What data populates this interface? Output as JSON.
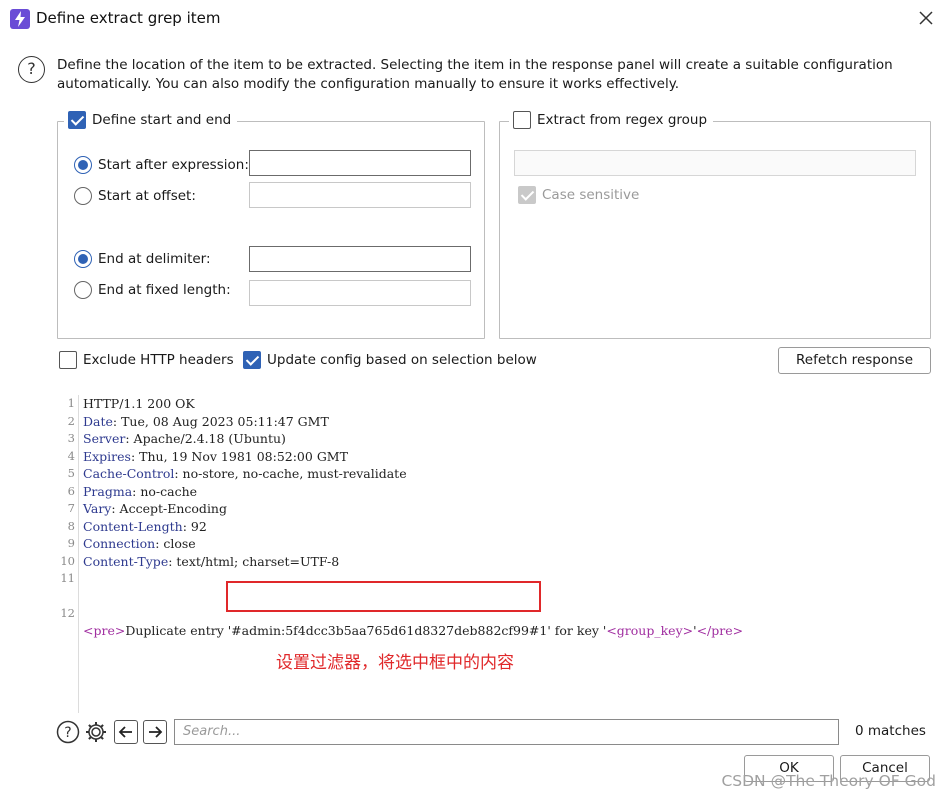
{
  "window": {
    "title": "Define extract grep item"
  },
  "description": "Define the location of the item to be extracted. Selecting the item in the response panel will create a suitable configuration automatically. You can also modify the configuration manually to ensure it works effectively.",
  "start_end_group": {
    "label": "Define start and end",
    "checked": true,
    "start_after_label": "Start after expression:",
    "start_after_value": "",
    "start_at_offset_label": "Start at offset:",
    "start_at_offset_value": "",
    "end_at_delimiter_label": "End at delimiter:",
    "end_at_delimiter_value": "",
    "end_fixed_length_label": "End at fixed length:",
    "end_fixed_length_value": ""
  },
  "regex_group": {
    "label": "Extract from regex group",
    "checked": false,
    "regex_value": "",
    "case_sensitive_label": "Case sensitive"
  },
  "options": {
    "exclude_headers_label": "Exclude HTTP headers",
    "update_config_label": "Update config based on selection below",
    "refetch_label": "Refetch response"
  },
  "response": {
    "lines": [
      {
        "n": "1",
        "name": "",
        "value": "HTTP/1.1 200 OK"
      },
      {
        "n": "2",
        "name": "Date",
        "value": ": Tue, 08 Aug 2023 05:11:47 GMT"
      },
      {
        "n": "3",
        "name": "Server",
        "value": ": Apache/2.4.18 (Ubuntu)"
      },
      {
        "n": "4",
        "name": "Expires",
        "value": ": Thu, 19 Nov 1981 08:52:00 GMT"
      },
      {
        "n": "5",
        "name": "Cache-Control",
        "value": ": no-store, no-cache, must-revalidate"
      },
      {
        "n": "6",
        "name": "Pragma",
        "value": ": no-cache"
      },
      {
        "n": "7",
        "name": "Vary",
        "value": ": Accept-Encoding"
      },
      {
        "n": "8",
        "name": "Content-Length",
        "value": ": 92"
      },
      {
        "n": "9",
        "name": "Connection",
        "value": ": close"
      },
      {
        "n": "10",
        "name": "Content-Type",
        "value": ": text/html; charset=UTF-8"
      },
      {
        "n": "11",
        "name": "",
        "value": ""
      }
    ],
    "body_line_number": "12",
    "body_tag_open": "<pre>",
    "body_text_before": "Duplicate entry ",
    "body_selected": "'#admin:5f4dcc3b5aa765d61d8327deb882cf99#1'",
    "body_text_after": " for key '",
    "body_group_key": "<group_key>",
    "body_quote_close": "'",
    "body_tag_close": "</pre>"
  },
  "annotation": "设置过滤器，将选中框中的内容",
  "search": {
    "placeholder": "Search...",
    "matches": "0 matches"
  },
  "buttons": {
    "ok": "OK",
    "cancel": "Cancel"
  },
  "watermark": "CSDN @The Theory OF God",
  "colors": {
    "accent": "#2f62b5",
    "annotation": "#e0282a",
    "header_name": "#2e3a8f",
    "tag": "#a02ea0"
  },
  "icons": [
    "burp-app-icon",
    "close-icon",
    "help-icon",
    "gear-icon",
    "arrow-left-icon",
    "arrow-right-icon"
  ]
}
